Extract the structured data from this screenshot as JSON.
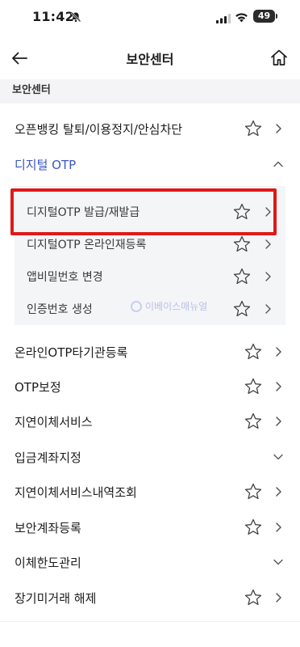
{
  "status_bar": {
    "time": "11:42",
    "battery": "49"
  },
  "header": {
    "title": "보안센터",
    "back_icon": "arrow-left-icon",
    "home_icon": "home-icon"
  },
  "section": {
    "title": "보안센터"
  },
  "items": [
    {
      "label": "오픈뱅킹 탈퇴/이용정지/안심차단",
      "control": "chevron-right"
    },
    {
      "label": "디지털 OTP",
      "control": "chevron-up",
      "accent": "#3b57c4"
    }
  ],
  "sub_items": [
    {
      "label": "디지털OTP 발급/재발급"
    },
    {
      "label": "디지털OTP 온라인재등록"
    },
    {
      "label": "앱비밀번호 변경"
    },
    {
      "label": "인증번호 생성"
    }
  ],
  "more_items": [
    {
      "label": "온라인OTP타기관등록",
      "control": "chevron-right"
    },
    {
      "label": "OTP보정",
      "control": "chevron-right"
    },
    {
      "label": "지연이체서비스",
      "control": "chevron-right"
    },
    {
      "label": "입금계좌지정",
      "control": "chevron-down"
    },
    {
      "label": "지연이체서비스내역조회",
      "control": "chevron-right"
    },
    {
      "label": "보안계좌등록",
      "control": "chevron-right"
    },
    {
      "label": "이체한도관리",
      "control": "chevron-down"
    },
    {
      "label": "장기미거래 해제",
      "control": "chevron-right"
    }
  ],
  "watermark": {
    "text": "이베이스매뉴얼"
  },
  "colors": {
    "accent": "#3b57c4",
    "highlight": "#e01919",
    "panel": "#f4f5f7"
  }
}
